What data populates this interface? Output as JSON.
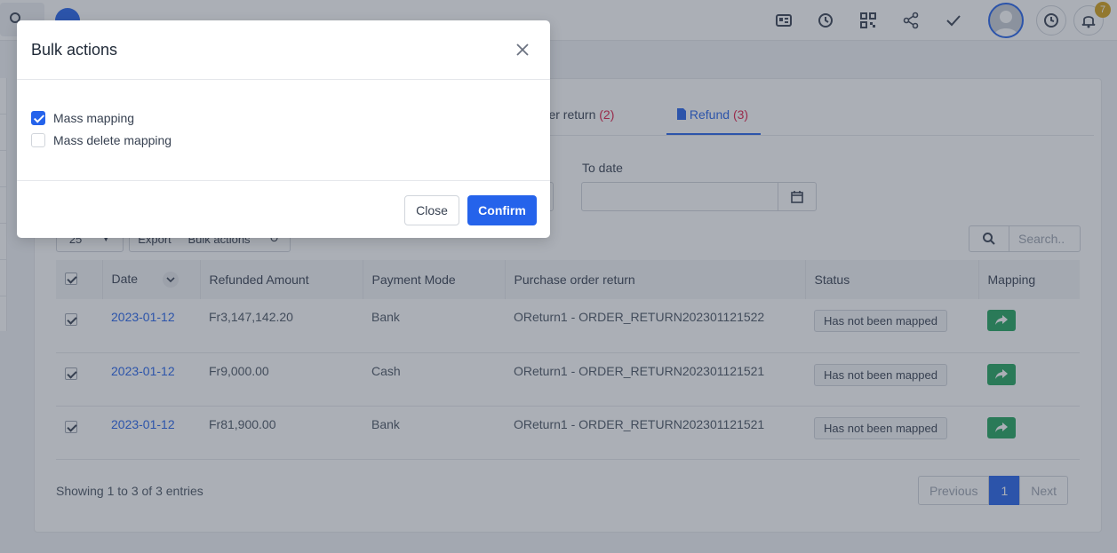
{
  "topbar": {
    "notification_count": "7"
  },
  "tabs": [
    {
      "label": "rder return",
      "count": "(2)"
    },
    {
      "label": "Refund",
      "count": "(3)"
    }
  ],
  "filters": {
    "to_date_label": "To date"
  },
  "toolbar": {
    "page_size": "25",
    "export_label": "Export",
    "bulk_label": "Bulk actions",
    "search_placeholder": "Search.."
  },
  "table": {
    "headers": [
      "Date",
      "Refunded Amount",
      "Payment Mode",
      "Purchase order return",
      "Status",
      "Mapping"
    ],
    "rows": [
      {
        "date": "2023-01-12",
        "amount": "Fr3,147,142.20",
        "mode": "Bank",
        "por": "OReturn1 - ORDER_RETURN202301121522",
        "status": "Has not been mapped"
      },
      {
        "date": "2023-01-12",
        "amount": "Fr9,000.00",
        "mode": "Cash",
        "por": "OReturn1 - ORDER_RETURN202301121521",
        "status": "Has not been mapped"
      },
      {
        "date": "2023-01-12",
        "amount": "Fr81,900.00",
        "mode": "Bank",
        "por": "OReturn1 - ORDER_RETURN202301121521",
        "status": "Has not been mapped"
      }
    ]
  },
  "footer": {
    "showing": "Showing 1 to 3 of 3 entries",
    "previous": "Previous",
    "page": "1",
    "next": "Next"
  },
  "modal": {
    "title": "Bulk actions",
    "options": [
      {
        "label": "Mass mapping",
        "checked": true
      },
      {
        "label": "Mass delete mapping",
        "checked": false
      }
    ],
    "close_label": "Close",
    "confirm_label": "Confirm"
  },
  "colors": {
    "accent": "#2563eb",
    "success": "#22a45d",
    "badge": "#d4a017",
    "count": "#e11d48"
  }
}
